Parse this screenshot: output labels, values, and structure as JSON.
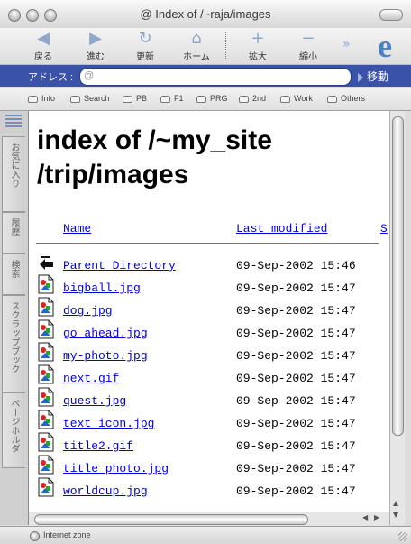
{
  "window": {
    "title": "@ Index of /~raja/images"
  },
  "toolbar": {
    "buttons": [
      {
        "label": "戻る",
        "icon": "back-arrow-icon",
        "glyph": "◀"
      },
      {
        "label": "進む",
        "icon": "forward-arrow-icon",
        "glyph": "▶"
      },
      {
        "label": "更新",
        "icon": "refresh-icon",
        "glyph": "↻"
      },
      {
        "label": "ホーム",
        "icon": "home-icon",
        "glyph": "⌂"
      },
      {
        "label": "拡大",
        "icon": "zoom-in-icon",
        "glyph": "+"
      },
      {
        "label": "縮小",
        "icon": "zoom-out-icon",
        "glyph": "−"
      }
    ],
    "overflow_glyph": "»",
    "logo_glyph": "e"
  },
  "address": {
    "label": "アドレス :",
    "value": "@",
    "go_label": "移動"
  },
  "favorites": [
    "Info",
    "Search",
    "PB",
    "F1",
    "PRG",
    "2nd",
    "Work",
    "Others"
  ],
  "sidebar_tabs": [
    "お気に入り",
    "履歴",
    "検索",
    "スクラップブック",
    "ページホルダ"
  ],
  "page": {
    "heading_line1": "index of /~my_site",
    "heading_line2": "/trip/images",
    "columns": {
      "name": "Name",
      "modified": "Last modified",
      "size": "S"
    },
    "rows": [
      {
        "name": "Parent Directory",
        "date": "09-Sep-2002 15:46",
        "icon": "back-folder-icon"
      },
      {
        "name": "bigball.jpg",
        "date": "09-Sep-2002 15:47",
        "icon": "image-file-icon"
      },
      {
        "name": "dog.jpg",
        "date": "09-Sep-2002 15:47",
        "icon": "image-file-icon"
      },
      {
        "name": "go_ahead.jpg",
        "date": "09-Sep-2002 15:47",
        "icon": "image-file-icon"
      },
      {
        "name": "my-photo.jpg",
        "date": "09-Sep-2002 15:47",
        "icon": "image-file-icon"
      },
      {
        "name": "next.gif",
        "date": "09-Sep-2002 15:47",
        "icon": "image-file-icon"
      },
      {
        "name": "quest.jpg",
        "date": "09-Sep-2002 15:47",
        "icon": "image-file-icon"
      },
      {
        "name": "text_icon.jpg",
        "date": "09-Sep-2002 15:47",
        "icon": "image-file-icon"
      },
      {
        "name": "title2.gif",
        "date": "09-Sep-2002 15:47",
        "icon": "image-file-icon"
      },
      {
        "name": "title_photo.jpg",
        "date": "09-Sep-2002 15:47",
        "icon": "image-file-icon"
      },
      {
        "name": "worldcup.jpg",
        "date": "09-Sep-2002 15:47",
        "icon": "image-file-icon"
      }
    ]
  },
  "status": {
    "text": "Internet zone"
  },
  "colors": {
    "address_bar": "#3a52a8",
    "link": "#0000dd",
    "toolbar_icon": "#8fa7c9"
  }
}
